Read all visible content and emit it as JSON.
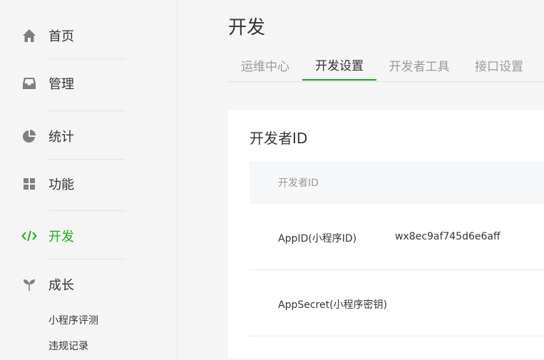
{
  "sidebar": {
    "items": [
      {
        "label": "首页",
        "icon": "home-icon"
      },
      {
        "label": "管理",
        "icon": "inbox-icon"
      },
      {
        "label": "统计",
        "icon": "pie-chart-icon"
      },
      {
        "label": "功能",
        "icon": "grid-icon"
      },
      {
        "label": "开发",
        "icon": "code-icon",
        "active": true
      },
      {
        "label": "成长",
        "icon": "sprout-icon"
      }
    ],
    "sub_items": [
      "小程序评测",
      "违规记录"
    ]
  },
  "main": {
    "title": "开发",
    "tabs": [
      {
        "label": "运维中心"
      },
      {
        "label": "开发设置",
        "active": true
      },
      {
        "label": "开发者工具"
      },
      {
        "label": "接口设置"
      }
    ],
    "card": {
      "title": "开发者ID",
      "table_header": "开发者ID",
      "rows": [
        {
          "key": "AppID(小程序ID)",
          "value": "wx8ec9af745d6e6aff"
        },
        {
          "key": "AppSecret(小程序密钥)",
          "value": ""
        }
      ]
    }
  },
  "colors": {
    "accent": "#1aad19",
    "icon_gray": "#7f7f7f",
    "text": "#353535",
    "muted": "#9a9a9a"
  }
}
